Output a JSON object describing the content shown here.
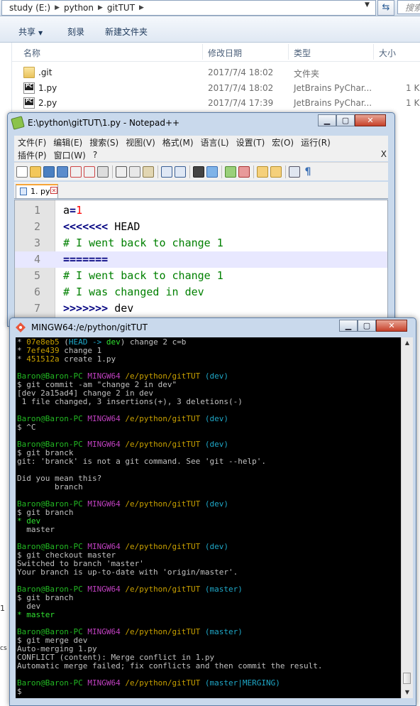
{
  "explorer": {
    "breadcrumbs": [
      "study (E:)",
      "python",
      "gitTUT"
    ],
    "search_placeholder": "搜索",
    "toolbar": {
      "organize": "共享",
      "burn": "刻录",
      "new_folder": "新建文件夹"
    },
    "columns": {
      "name": "名称",
      "modified": "修改日期",
      "type": "类型",
      "size": "大小"
    },
    "files": [
      {
        "name": ".git",
        "date": "2017/7/4 18:02",
        "type": "文件夹",
        "size": ""
      },
      {
        "name": "1.py",
        "date": "2017/7/4 18:02",
        "type": "JetBrains PyChar...",
        "size": "1 K"
      },
      {
        "name": "2.py",
        "date": "2017/7/4 17:39",
        "type": "JetBrains PyChar...",
        "size": "1 K"
      }
    ],
    "left_stub_1": "1",
    "left_stub_2": "cs"
  },
  "notepad": {
    "title": "E:\\python\\gitTUT\\1.py - Notepad++",
    "menu_row1": [
      "文件(F)",
      "编辑(E)",
      "搜索(S)",
      "视图(V)",
      "格式(M)",
      "语言(L)",
      "设置(T)",
      "宏(O)",
      "运行(R)"
    ],
    "menu_row2": [
      "插件(P)",
      "窗口(W)",
      "?"
    ],
    "menu_close": "X",
    "tab": "1. py",
    "lines": [
      {
        "n": "1",
        "parts": [
          {
            "t": "a",
            "c": "c-black"
          },
          {
            "t": "=",
            "c": "c-navy"
          },
          {
            "t": "1",
            "c": "c-red"
          }
        ]
      },
      {
        "n": "2",
        "parts": [
          {
            "t": "<<<<<<<",
            "c": "c-navy"
          },
          {
            "t": " HEAD",
            "c": "c-black"
          }
        ]
      },
      {
        "n": "3",
        "parts": [
          {
            "t": "# I went back to change 1",
            "c": "c-green"
          }
        ]
      },
      {
        "n": "4",
        "parts": [
          {
            "t": "=======",
            "c": "c-navy"
          }
        ]
      },
      {
        "n": "5",
        "parts": [
          {
            "t": "# I went back to change 1",
            "c": "c-green"
          }
        ]
      },
      {
        "n": "6",
        "parts": [
          {
            "t": "# I was changed in dev",
            "c": "c-green"
          }
        ]
      },
      {
        "n": "7",
        "parts": [
          {
            "t": ">>>>>>>",
            "c": "c-navy"
          },
          {
            "t": " dev",
            "c": "c-black"
          }
        ]
      }
    ]
  },
  "terminal": {
    "title": "MINGW64:/e/python/gitTUT",
    "lines": [
      [
        {
          "t": "* ",
          "c": "t-w"
        },
        {
          "t": "07e8eb5",
          "c": "t-y"
        },
        {
          "t": " (",
          "c": "t-w"
        },
        {
          "t": "HEAD -> ",
          "c": "t-c"
        },
        {
          "t": "dev",
          "c": "t-lg"
        },
        {
          "t": ") change 2 c=b",
          "c": "t-w"
        }
      ],
      [
        {
          "t": "* ",
          "c": "t-w"
        },
        {
          "t": "7efe439",
          "c": "t-y"
        },
        {
          "t": " change 1",
          "c": "t-w"
        }
      ],
      [
        {
          "t": "* ",
          "c": "t-w"
        },
        {
          "t": "451512a",
          "c": "t-y"
        },
        {
          "t": " create 1.py",
          "c": "t-w"
        }
      ],
      [],
      [
        {
          "t": "Baron@Baron-PC ",
          "c": "t-g"
        },
        {
          "t": "MINGW64 ",
          "c": "t-m"
        },
        {
          "t": "/e/python/gitTUT ",
          "c": "t-y"
        },
        {
          "t": "(dev)",
          "c": "t-c"
        }
      ],
      [
        {
          "t": "$ git commit -am \"change 2 in dev\"",
          "c": "t-w"
        }
      ],
      [
        {
          "t": "[dev 2a15ad4] change 2 in dev",
          "c": "t-w"
        }
      ],
      [
        {
          "t": " 1 file changed, 3 insertions(+), 3 deletions(-)",
          "c": "t-w"
        }
      ],
      [],
      [
        {
          "t": "Baron@Baron-PC ",
          "c": "t-g"
        },
        {
          "t": "MINGW64 ",
          "c": "t-m"
        },
        {
          "t": "/e/python/gitTUT ",
          "c": "t-y"
        },
        {
          "t": "(dev)",
          "c": "t-c"
        }
      ],
      [
        {
          "t": "$ ^C",
          "c": "t-w"
        }
      ],
      [],
      [
        {
          "t": "Baron@Baron-PC ",
          "c": "t-g"
        },
        {
          "t": "MINGW64 ",
          "c": "t-m"
        },
        {
          "t": "/e/python/gitTUT ",
          "c": "t-y"
        },
        {
          "t": "(dev)",
          "c": "t-c"
        }
      ],
      [
        {
          "t": "$ git branck",
          "c": "t-w"
        }
      ],
      [
        {
          "t": "git: 'branck' is not a git command. See 'git --help'.",
          "c": "t-w"
        }
      ],
      [],
      [
        {
          "t": "Did you mean this?",
          "c": "t-w"
        }
      ],
      [
        {
          "t": "        branch",
          "c": "t-w"
        }
      ],
      [],
      [
        {
          "t": "Baron@Baron-PC ",
          "c": "t-g"
        },
        {
          "t": "MINGW64 ",
          "c": "t-m"
        },
        {
          "t": "/e/python/gitTUT ",
          "c": "t-y"
        },
        {
          "t": "(dev)",
          "c": "t-c"
        }
      ],
      [
        {
          "t": "$ git branch",
          "c": "t-w"
        }
      ],
      [
        {
          "t": "* dev",
          "c": "t-lg"
        }
      ],
      [
        {
          "t": "  master",
          "c": "t-w"
        }
      ],
      [],
      [
        {
          "t": "Baron@Baron-PC ",
          "c": "t-g"
        },
        {
          "t": "MINGW64 ",
          "c": "t-m"
        },
        {
          "t": "/e/python/gitTUT ",
          "c": "t-y"
        },
        {
          "t": "(dev)",
          "c": "t-c"
        }
      ],
      [
        {
          "t": "$ git checkout master",
          "c": "t-w"
        }
      ],
      [
        {
          "t": "Switched to branch 'master'",
          "c": "t-w"
        }
      ],
      [
        {
          "t": "Your branch is up-to-date with 'origin/master'.",
          "c": "t-w"
        }
      ],
      [],
      [
        {
          "t": "Baron@Baron-PC ",
          "c": "t-g"
        },
        {
          "t": "MINGW64 ",
          "c": "t-m"
        },
        {
          "t": "/e/python/gitTUT ",
          "c": "t-y"
        },
        {
          "t": "(master)",
          "c": "t-c"
        }
      ],
      [
        {
          "t": "$ git branch",
          "c": "t-w"
        }
      ],
      [
        {
          "t": "  dev",
          "c": "t-w"
        }
      ],
      [
        {
          "t": "* master",
          "c": "t-lg"
        }
      ],
      [],
      [
        {
          "t": "Baron@Baron-PC ",
          "c": "t-g"
        },
        {
          "t": "MINGW64 ",
          "c": "t-m"
        },
        {
          "t": "/e/python/gitTUT ",
          "c": "t-y"
        },
        {
          "t": "(master)",
          "c": "t-c"
        }
      ],
      [
        {
          "t": "$ git merge dev",
          "c": "t-w"
        }
      ],
      [
        {
          "t": "Auto-merging 1.py",
          "c": "t-w"
        }
      ],
      [
        {
          "t": "CONFLICT (content): Merge conflict in 1.py",
          "c": "t-w"
        }
      ],
      [
        {
          "t": "Automatic merge failed; fix conflicts and then commit the result.",
          "c": "t-w"
        }
      ],
      [],
      [
        {
          "t": "Baron@Baron-PC ",
          "c": "t-g"
        },
        {
          "t": "MINGW64 ",
          "c": "t-m"
        },
        {
          "t": "/e/python/gitTUT ",
          "c": "t-y"
        },
        {
          "t": "(master|MERGING)",
          "c": "t-c"
        }
      ],
      [
        {
          "t": "$",
          "c": "t-w"
        }
      ]
    ]
  }
}
